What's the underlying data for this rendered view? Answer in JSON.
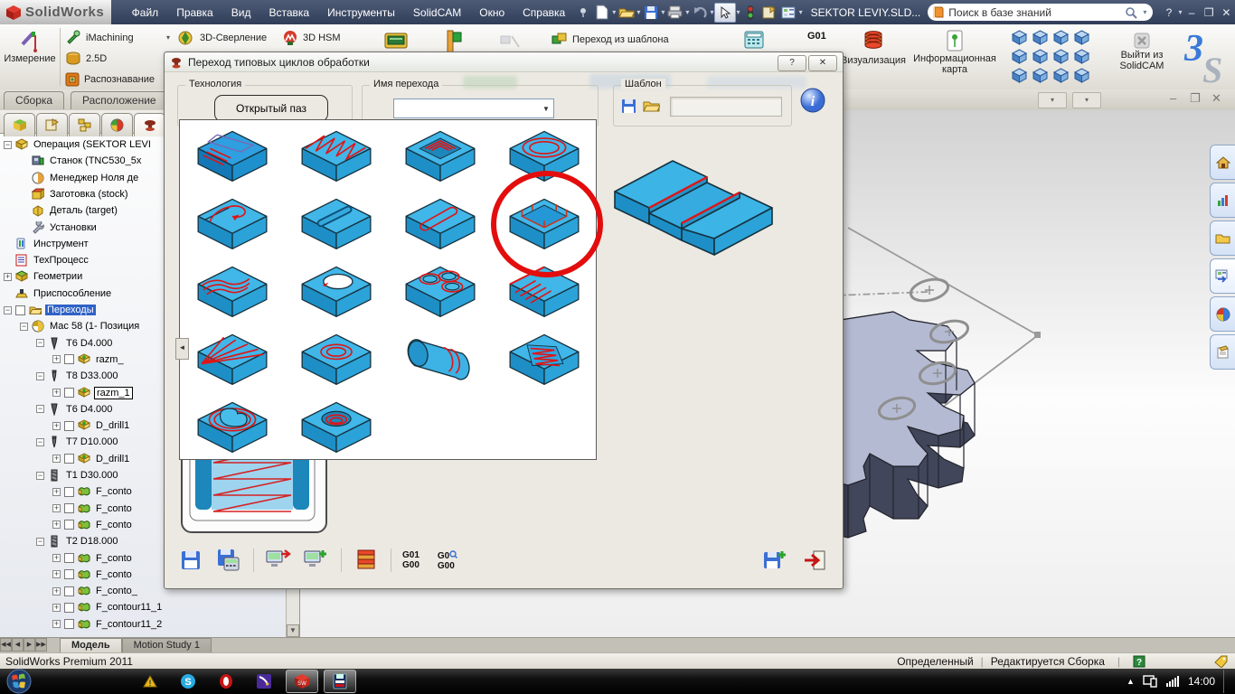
{
  "menubar": {
    "logo": "SolidWorks",
    "menus": [
      "Файл",
      "Правка",
      "Вид",
      "Вставка",
      "Инструменты",
      "SolidCAM",
      "Окно",
      "Справка"
    ],
    "doc_title": "SEKTOR LEVIY.SLD...",
    "search_placeholder": "Поиск в базе знаний",
    "help": "?",
    "minimize": "–",
    "restore": "❐",
    "close": "✕"
  },
  "toolbar": {
    "measure": "Измерение",
    "imachining": "iMachining",
    "d25": "2.5D",
    "recognition": "Распознавание",
    "drill3d": "3D-Сверление",
    "hsm": "3D HSM",
    "from_template": "Переход из шаблона",
    "g01": "G01",
    "visualization": "Визуализация",
    "info_card": "Информационная карта",
    "exit_solidcam": "Выйти из SolidCAM",
    "view_cubes_count": 12
  },
  "doc_tabs": {
    "assembly": "Сборка",
    "layout": "Расположение"
  },
  "tree": {
    "items": [
      {
        "l": "Операция (SEKTOR LEVI",
        "d": 0,
        "ic": "op",
        "ex": "-"
      },
      {
        "l": "Станок (TNC530_5x",
        "d": 1,
        "ic": "machine"
      },
      {
        "l": "Менеджер Ноля де",
        "d": 1,
        "ic": "zero"
      },
      {
        "l": "Заготовка (stock)",
        "d": 1,
        "ic": "stock"
      },
      {
        "l": "Деталь (target)",
        "d": 1,
        "ic": "target"
      },
      {
        "l": "Установки",
        "d": 1,
        "ic": "wrench"
      },
      {
        "l": "Инструмент",
        "d": 0,
        "ic": "toolmgr"
      },
      {
        "l": "ТехПроцесс",
        "d": 0,
        "ic": "process"
      },
      {
        "l": "Геометрии",
        "d": 0,
        "ic": "geom",
        "ex": "+"
      },
      {
        "l": "Приспособление",
        "d": 0,
        "ic": "fixture"
      },
      {
        "l": "Переходы",
        "d": 0,
        "ic": "folder",
        "ex": "-",
        "cb": true,
        "sel": true
      },
      {
        "l": "Мас 58 (1- Позиция",
        "d": 1,
        "ic": "pos",
        "ex": "-"
      },
      {
        "l": "T6  D4.000",
        "d": 2,
        "ic": "tmill",
        "ex": "-"
      },
      {
        "l": "razm_",
        "d": 3,
        "ic": "opg",
        "ex": "+",
        "cb": true
      },
      {
        "l": "T8  D33.000",
        "d": 2,
        "ic": "tdrill",
        "ex": "-"
      },
      {
        "l": "razm_1",
        "d": 3,
        "ic": "opg",
        "ex": "+",
        "cb": true,
        "box": true
      },
      {
        "l": "T6  D4.000",
        "d": 2,
        "ic": "tmill",
        "ex": "-"
      },
      {
        "l": "D_drill1",
        "d": 3,
        "ic": "opg",
        "ex": "+",
        "cb": true
      },
      {
        "l": "T7  D10.000",
        "d": 2,
        "ic": "tdrill",
        "ex": "-"
      },
      {
        "l": "D_drill1",
        "d": 3,
        "ic": "opg",
        "ex": "+",
        "cb": true
      },
      {
        "l": "T1  D30.000",
        "d": 2,
        "ic": "tmill2",
        "ex": "-"
      },
      {
        "l": "F_conto",
        "d": 3,
        "ic": "opc",
        "ex": "+",
        "cb": true
      },
      {
        "l": "F_conto",
        "d": 3,
        "ic": "opc",
        "ex": "+",
        "cb": true
      },
      {
        "l": "F_conto",
        "d": 3,
        "ic": "opc",
        "ex": "+",
        "cb": true
      },
      {
        "l": "T2  D18.000",
        "d": 2,
        "ic": "tmill2",
        "ex": "-"
      },
      {
        "l": "F_conto",
        "d": 3,
        "ic": "opc",
        "ex": "+",
        "cb": true
      },
      {
        "l": "F_conto",
        "d": 3,
        "ic": "opc",
        "ex": "+",
        "cb": true
      },
      {
        "l": "F_conto_",
        "d": 3,
        "ic": "opc",
        "ex": "+",
        "cb": true
      },
      {
        "l": "F_contour11_1",
        "d": 3,
        "ic": "opc",
        "ex": "+",
        "cb": true
      },
      {
        "l": "F_contour11_2",
        "d": 3,
        "ic": "opc",
        "ex": "+",
        "cb": true
      }
    ]
  },
  "dialog": {
    "title": "Переход типовых циклов обработки",
    "help": "?",
    "close": "✕",
    "tech_label": "Технология",
    "tech_button": "Открытый паз",
    "name_label": "Имя перехода",
    "template_label": "Шаблон",
    "thumbnails": [
      "facemill",
      "zigzag",
      "upocket",
      "ovalpath",
      "steploop",
      "angslot",
      "slotoutline",
      "chamfer",
      "wave",
      "hole",
      "bosses",
      "slope",
      "fan",
      "circleface",
      "cylinder",
      "zigzag3d",
      "bossspiral",
      "roundpocket"
    ],
    "selected_thumbnail_index": 7,
    "gcode1_top": "G01",
    "gcode1_bot": "G00",
    "gcode2_top": "G0",
    "gcode2_bot": "G00"
  },
  "model_tabs": {
    "model": "Модель",
    "motion": "Motion Study 1"
  },
  "statusbar": {
    "left": "SolidWorks Premium 2011",
    "state": "Определенный",
    "mode": "Редактируется Сборка"
  },
  "taskbar": {
    "clock": "14:00"
  },
  "accent_colors": {
    "thumb_blue": "#3db2e5",
    "toolpath_red": "#e11414",
    "selection_blue": "#2f62c6",
    "circle_red": "#e30d0d"
  }
}
